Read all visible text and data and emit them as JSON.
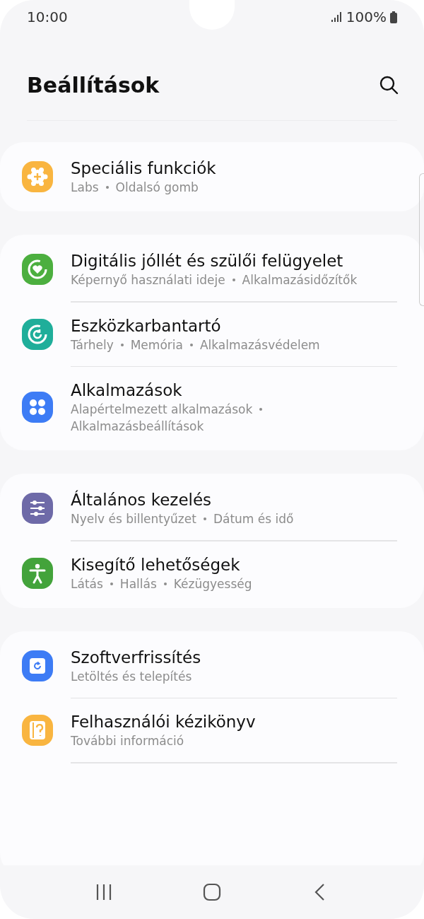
{
  "status_bar": {
    "time": "10:00",
    "battery": "100%"
  },
  "header": {
    "title": "Beállítások"
  },
  "groups": [
    {
      "items": [
        {
          "color": "#f9b540",
          "title": "Speciális funkciók",
          "details": [
            "Labs",
            "Oldalsó gomb"
          ]
        }
      ]
    },
    {
      "items": [
        {
          "color": "#4caf3f",
          "title": "Digitális jóllét és szülői felügyelet",
          "details": [
            "Képernyő használati ideje",
            "Alkalmazásidőzítők"
          ]
        },
        {
          "color": "#1fae9a",
          "title": "Eszközkarbantartó",
          "details": [
            "Tárhely",
            "Memória",
            "Alkalmazásvédelem"
          ]
        },
        {
          "color": "#3d7cf5",
          "title": "Alkalmazások",
          "details": [
            "Alapértelmezett alkalmazások",
            "Alkalmazásbeállítások"
          ]
        }
      ]
    },
    {
      "items": [
        {
          "color": "#6e6aa8",
          "title": "Általános kezelés",
          "details": [
            "Nyelv és billentyűzet",
            "Dátum és idő"
          ]
        },
        {
          "color": "#43a33b",
          "title": "Kisegítő lehetőségek",
          "details": [
            "Látás",
            "Hallás",
            "Kézügyesség"
          ]
        }
      ]
    },
    {
      "items": [
        {
          "color": "#3d7cf5",
          "title": "Szoftverfrissítés",
          "details": [
            "Letöltés és telepítés"
          ]
        },
        {
          "color": "#f9b540",
          "title": "Felhasználói kézikönyv",
          "details": [
            "További információ"
          ]
        }
      ]
    }
  ]
}
